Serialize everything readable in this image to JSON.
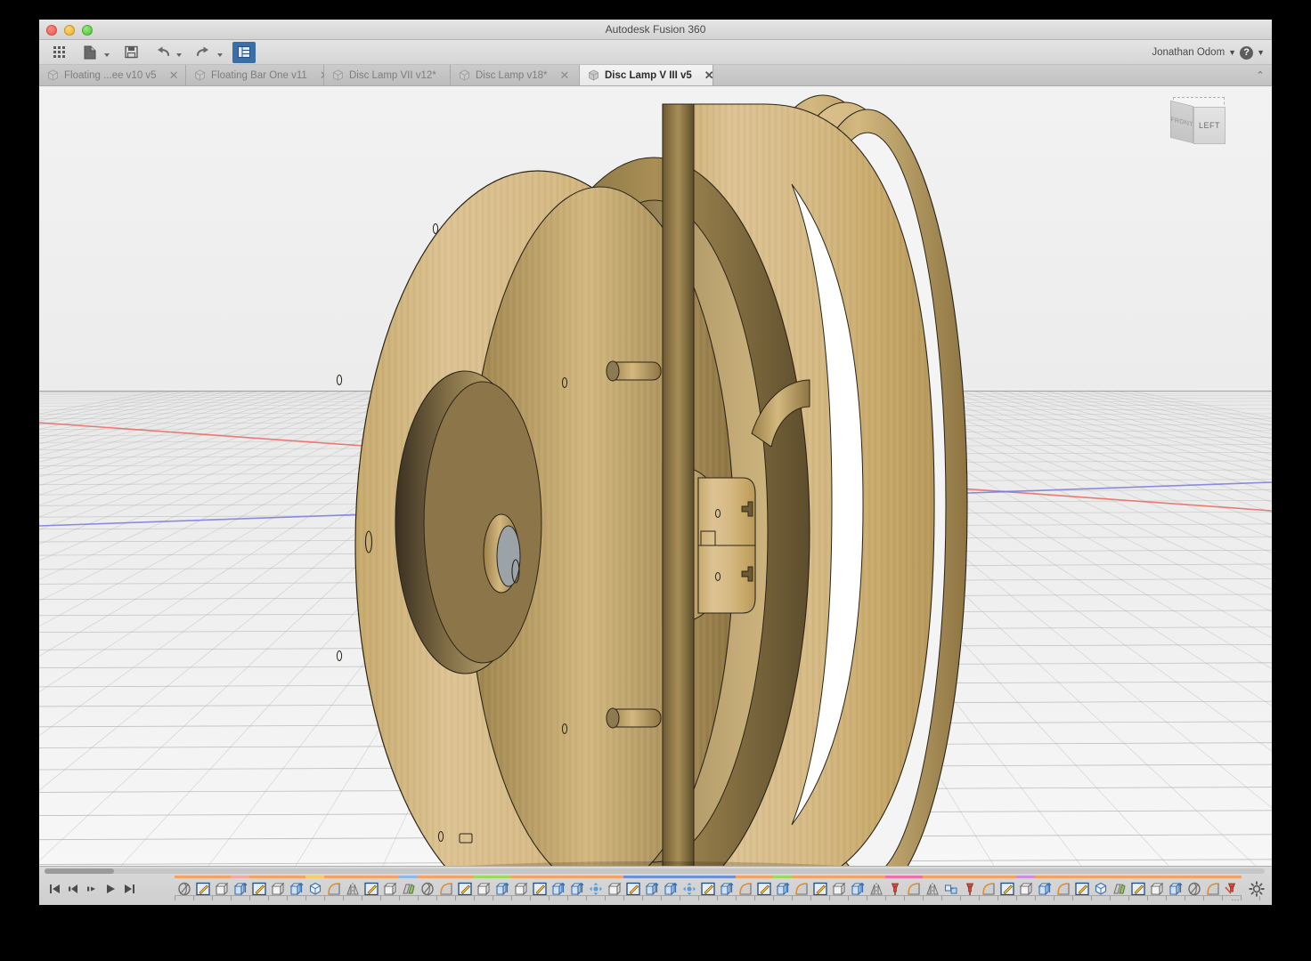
{
  "window": {
    "title": "Autodesk Fusion 360",
    "traffic_lights": [
      "close",
      "minimize",
      "zoom"
    ]
  },
  "toolbar": {
    "buttons": [
      {
        "name": "show-data-panel-button",
        "icon": "grid-icon",
        "label": "",
        "caret": false,
        "active": false
      },
      {
        "name": "file-menu-button",
        "icon": "file-icon",
        "label": "",
        "caret": true,
        "active": false
      },
      {
        "name": "save-button",
        "icon": "save-icon",
        "label": "",
        "caret": false,
        "active": false
      },
      {
        "name": "undo-button",
        "icon": "undo-arrow-icon",
        "label": "",
        "caret": true,
        "active": false
      },
      {
        "name": "redo-button",
        "icon": "redo-arrow-icon",
        "label": "",
        "caret": true,
        "active": false
      },
      {
        "name": "panel-toggle-button",
        "icon": "panel-layout-icon",
        "label": "",
        "caret": false,
        "active": true
      }
    ],
    "user_name": "Jonathan Odom",
    "user_caret": "▼",
    "help_label": "?",
    "help_caret": "▼"
  },
  "tabs": {
    "items": [
      {
        "label": "Floating ...ee v10 v5",
        "active": false,
        "close": "✕",
        "icon": "document-cube-icon"
      },
      {
        "label": "Floating Bar One v11",
        "active": false,
        "close": "✕",
        "icon": "document-cube-icon"
      },
      {
        "label": "Disc Lamp VII v12*",
        "active": false,
        "close": "✕",
        "icon": "document-cube-icon"
      },
      {
        "label": "Disc Lamp v18*",
        "active": false,
        "close": "✕",
        "icon": "document-cube-icon"
      },
      {
        "label": "Disc Lamp V III v5",
        "active": true,
        "close": "✕",
        "icon": "document-cube-icon"
      }
    ],
    "collapse_caret": "⌃"
  },
  "viewport": {
    "viewcube": {
      "front_label": "FRONT",
      "right_label": "LEFT",
      "top_label": ""
    },
    "model": {
      "name": "disc-lamp-assembly",
      "material_color": "#c8a96a",
      "material_light": "#ddc18d",
      "material_dark": "#9b8149",
      "edge_color": "#2b2518"
    },
    "axes": {
      "x_color": "#e8695f",
      "y_color": "#7b79e0",
      "grid_color": "#a9a9a9",
      "sky_color": "#f1f1f1",
      "ground_color": "#efefef"
    }
  },
  "timeline": {
    "playback": [
      {
        "name": "timeline-skip-start-button",
        "glyph": "skip-start"
      },
      {
        "name": "timeline-step-back-button",
        "glyph": "step-back"
      },
      {
        "name": "timeline-step-forward-button",
        "glyph": "step-forward"
      },
      {
        "name": "timeline-play-button",
        "glyph": "play"
      },
      {
        "name": "timeline-skip-end-button",
        "glyph": "skip-end"
      }
    ],
    "settings_label": "timeline-settings",
    "overflow_label": "…",
    "groups": [
      {
        "color": "#f2a365",
        "count": 3
      },
      {
        "color": "#f0aaa8",
        "count": 1
      },
      {
        "color": "#f2a365",
        "count": 3
      },
      {
        "color": "#f2cf6a",
        "count": 1
      },
      {
        "color": "#f2a365",
        "count": 5
      },
      {
        "color": "#8fb8e8",
        "count": 1
      }
    ],
    "features": [
      {
        "icon": "revolve-icon",
        "bar": "#f2a365"
      },
      {
        "icon": "sketch-icon",
        "bar": "#f2a365"
      },
      {
        "icon": "shell-icon",
        "bar": "#f2a365"
      },
      {
        "icon": "extrude-icon",
        "bar": "#f0aaa8"
      },
      {
        "icon": "sketch-icon",
        "bar": "#f2a365"
      },
      {
        "icon": "shell-icon",
        "bar": "#f2a365"
      },
      {
        "icon": "extrude-icon",
        "bar": "#f2a365"
      },
      {
        "icon": "component-icon",
        "bar": "#f2cf6a"
      },
      {
        "icon": "fillet-icon",
        "bar": "#f2a365"
      },
      {
        "icon": "mirror-icon",
        "bar": "#f2a365"
      },
      {
        "icon": "sketch-icon",
        "bar": "#f2a365"
      },
      {
        "icon": "shell-icon",
        "bar": "#f2a365"
      },
      {
        "icon": "loft-icon",
        "bar": "#8fb8e8"
      },
      {
        "icon": "revolve-icon",
        "bar": "#f2a365"
      },
      {
        "icon": "fillet-icon",
        "bar": "#f2a365"
      },
      {
        "icon": "sketch-icon",
        "bar": "#f2a365"
      },
      {
        "icon": "shell-icon",
        "bar": "#9fd860"
      },
      {
        "icon": "extrude-icon",
        "bar": "#9fd860"
      },
      {
        "icon": "shell-icon",
        "bar": "#f2a365"
      },
      {
        "icon": "sketch-icon",
        "bar": "#f2a365"
      },
      {
        "icon": "extrude-icon",
        "bar": "#f2a365"
      },
      {
        "icon": "extrude-icon",
        "bar": "#f2a365"
      },
      {
        "icon": "move-icon",
        "bar": "#f2a365"
      },
      {
        "icon": "shell-icon",
        "bar": "#f2a365"
      },
      {
        "icon": "sketch-icon",
        "bar": "#6e8fd8"
      },
      {
        "icon": "extrude-icon",
        "bar": "#6e8fd8"
      },
      {
        "icon": "extrude-icon",
        "bar": "#6e8fd8"
      },
      {
        "icon": "move-icon",
        "bar": "#6e8fd8"
      },
      {
        "icon": "sketch-icon",
        "bar": "#6e8fd8"
      },
      {
        "icon": "extrude-icon",
        "bar": "#6e8fd8"
      },
      {
        "icon": "fillet-icon",
        "bar": "#f2a365"
      },
      {
        "icon": "sketch-icon",
        "bar": "#f2a365"
      },
      {
        "icon": "extrude-icon",
        "bar": "#9fd860"
      },
      {
        "icon": "fillet-icon",
        "bar": "#f2a365"
      },
      {
        "icon": "sketch-icon",
        "bar": "#f2a365"
      },
      {
        "icon": "shell-icon",
        "bar": "#f2a365"
      },
      {
        "icon": "extrude-icon",
        "bar": "#f2a365"
      },
      {
        "icon": "mirror-icon",
        "bar": "#f2a365"
      },
      {
        "icon": "joint-icon",
        "bar": "#ef6fa8"
      },
      {
        "icon": "fillet-icon",
        "bar": "#ef6fa8"
      },
      {
        "icon": "mirror-icon",
        "bar": "#f2a365"
      },
      {
        "icon": "rigid-group-icon",
        "bar": "#f2a365"
      },
      {
        "icon": "joint-icon",
        "bar": "#f2a365"
      },
      {
        "icon": "fillet-icon",
        "bar": "#f2a365"
      },
      {
        "icon": "sketch-icon",
        "bar": "#f2a365"
      },
      {
        "icon": "shell-icon",
        "bar": "#c98fe0"
      },
      {
        "icon": "extrude-icon",
        "bar": "#f2a365"
      },
      {
        "icon": "fillet-icon",
        "bar": "#f2a365"
      },
      {
        "icon": "sketch-icon",
        "bar": "#f2a365"
      },
      {
        "icon": "component-icon",
        "bar": "#f2a365"
      },
      {
        "icon": "loft-icon",
        "bar": "#f2a365"
      },
      {
        "icon": "sketch-icon",
        "bar": "#f2a365"
      },
      {
        "icon": "shell-icon",
        "bar": "#f2a365"
      },
      {
        "icon": "extrude-icon",
        "bar": "#f2a365"
      },
      {
        "icon": "revolve-icon",
        "bar": "#f2a365"
      },
      {
        "icon": "fillet-icon",
        "bar": "#f2a365"
      },
      {
        "icon": "joint-suppress-icon",
        "bar": "#f2a365"
      },
      {
        "icon": "suppressed-icon",
        "bar": "#f2a365"
      },
      {
        "icon": "suppressed-icon",
        "bar": "#f2a365"
      },
      {
        "icon": "fillet-icon",
        "bar": "#f2a365"
      },
      {
        "icon": "joint-icon",
        "bar": "#f2a365"
      },
      {
        "icon": "loft-icon",
        "bar": "#f2a365"
      },
      {
        "icon": "sketch-icon",
        "bar": "#f2a365"
      },
      {
        "icon": "shell-icon",
        "bar": "#f0aaa8"
      },
      {
        "icon": "extrude-icon",
        "bar": "#f0aaa8"
      },
      {
        "icon": "extrude-icon",
        "bar": "#9fd860"
      }
    ]
  }
}
